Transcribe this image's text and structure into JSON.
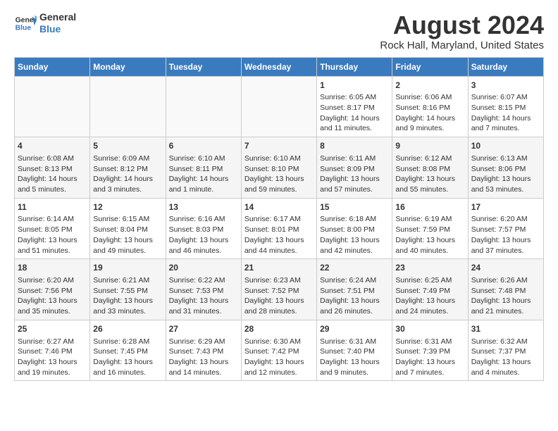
{
  "logo": {
    "line1": "General",
    "line2": "Blue"
  },
  "title": "August 2024",
  "subtitle": "Rock Hall, Maryland, United States",
  "weekdays": [
    "Sunday",
    "Monday",
    "Tuesday",
    "Wednesday",
    "Thursday",
    "Friday",
    "Saturday"
  ],
  "weeks": [
    [
      {
        "day": "",
        "info": ""
      },
      {
        "day": "",
        "info": ""
      },
      {
        "day": "",
        "info": ""
      },
      {
        "day": "",
        "info": ""
      },
      {
        "day": "1",
        "info": "Sunrise: 6:05 AM\nSunset: 8:17 PM\nDaylight: 14 hours and 11 minutes."
      },
      {
        "day": "2",
        "info": "Sunrise: 6:06 AM\nSunset: 8:16 PM\nDaylight: 14 hours and 9 minutes."
      },
      {
        "day": "3",
        "info": "Sunrise: 6:07 AM\nSunset: 8:15 PM\nDaylight: 14 hours and 7 minutes."
      }
    ],
    [
      {
        "day": "4",
        "info": "Sunrise: 6:08 AM\nSunset: 8:13 PM\nDaylight: 14 hours and 5 minutes."
      },
      {
        "day": "5",
        "info": "Sunrise: 6:09 AM\nSunset: 8:12 PM\nDaylight: 14 hours and 3 minutes."
      },
      {
        "day": "6",
        "info": "Sunrise: 6:10 AM\nSunset: 8:11 PM\nDaylight: 14 hours and 1 minute."
      },
      {
        "day": "7",
        "info": "Sunrise: 6:10 AM\nSunset: 8:10 PM\nDaylight: 13 hours and 59 minutes."
      },
      {
        "day": "8",
        "info": "Sunrise: 6:11 AM\nSunset: 8:09 PM\nDaylight: 13 hours and 57 minutes."
      },
      {
        "day": "9",
        "info": "Sunrise: 6:12 AM\nSunset: 8:08 PM\nDaylight: 13 hours and 55 minutes."
      },
      {
        "day": "10",
        "info": "Sunrise: 6:13 AM\nSunset: 8:06 PM\nDaylight: 13 hours and 53 minutes."
      }
    ],
    [
      {
        "day": "11",
        "info": "Sunrise: 6:14 AM\nSunset: 8:05 PM\nDaylight: 13 hours and 51 minutes."
      },
      {
        "day": "12",
        "info": "Sunrise: 6:15 AM\nSunset: 8:04 PM\nDaylight: 13 hours and 49 minutes."
      },
      {
        "day": "13",
        "info": "Sunrise: 6:16 AM\nSunset: 8:03 PM\nDaylight: 13 hours and 46 minutes."
      },
      {
        "day": "14",
        "info": "Sunrise: 6:17 AM\nSunset: 8:01 PM\nDaylight: 13 hours and 44 minutes."
      },
      {
        "day": "15",
        "info": "Sunrise: 6:18 AM\nSunset: 8:00 PM\nDaylight: 13 hours and 42 minutes."
      },
      {
        "day": "16",
        "info": "Sunrise: 6:19 AM\nSunset: 7:59 PM\nDaylight: 13 hours and 40 minutes."
      },
      {
        "day": "17",
        "info": "Sunrise: 6:20 AM\nSunset: 7:57 PM\nDaylight: 13 hours and 37 minutes."
      }
    ],
    [
      {
        "day": "18",
        "info": "Sunrise: 6:20 AM\nSunset: 7:56 PM\nDaylight: 13 hours and 35 minutes."
      },
      {
        "day": "19",
        "info": "Sunrise: 6:21 AM\nSunset: 7:55 PM\nDaylight: 13 hours and 33 minutes."
      },
      {
        "day": "20",
        "info": "Sunrise: 6:22 AM\nSunset: 7:53 PM\nDaylight: 13 hours and 31 minutes."
      },
      {
        "day": "21",
        "info": "Sunrise: 6:23 AM\nSunset: 7:52 PM\nDaylight: 13 hours and 28 minutes."
      },
      {
        "day": "22",
        "info": "Sunrise: 6:24 AM\nSunset: 7:51 PM\nDaylight: 13 hours and 26 minutes."
      },
      {
        "day": "23",
        "info": "Sunrise: 6:25 AM\nSunset: 7:49 PM\nDaylight: 13 hours and 24 minutes."
      },
      {
        "day": "24",
        "info": "Sunrise: 6:26 AM\nSunset: 7:48 PM\nDaylight: 13 hours and 21 minutes."
      }
    ],
    [
      {
        "day": "25",
        "info": "Sunrise: 6:27 AM\nSunset: 7:46 PM\nDaylight: 13 hours and 19 minutes."
      },
      {
        "day": "26",
        "info": "Sunrise: 6:28 AM\nSunset: 7:45 PM\nDaylight: 13 hours and 16 minutes."
      },
      {
        "day": "27",
        "info": "Sunrise: 6:29 AM\nSunset: 7:43 PM\nDaylight: 13 hours and 14 minutes."
      },
      {
        "day": "28",
        "info": "Sunrise: 6:30 AM\nSunset: 7:42 PM\nDaylight: 13 hours and 12 minutes."
      },
      {
        "day": "29",
        "info": "Sunrise: 6:31 AM\nSunset: 7:40 PM\nDaylight: 13 hours and 9 minutes."
      },
      {
        "day": "30",
        "info": "Sunrise: 6:31 AM\nSunset: 7:39 PM\nDaylight: 13 hours and 7 minutes."
      },
      {
        "day": "31",
        "info": "Sunrise: 6:32 AM\nSunset: 7:37 PM\nDaylight: 13 hours and 4 minutes."
      }
    ]
  ]
}
